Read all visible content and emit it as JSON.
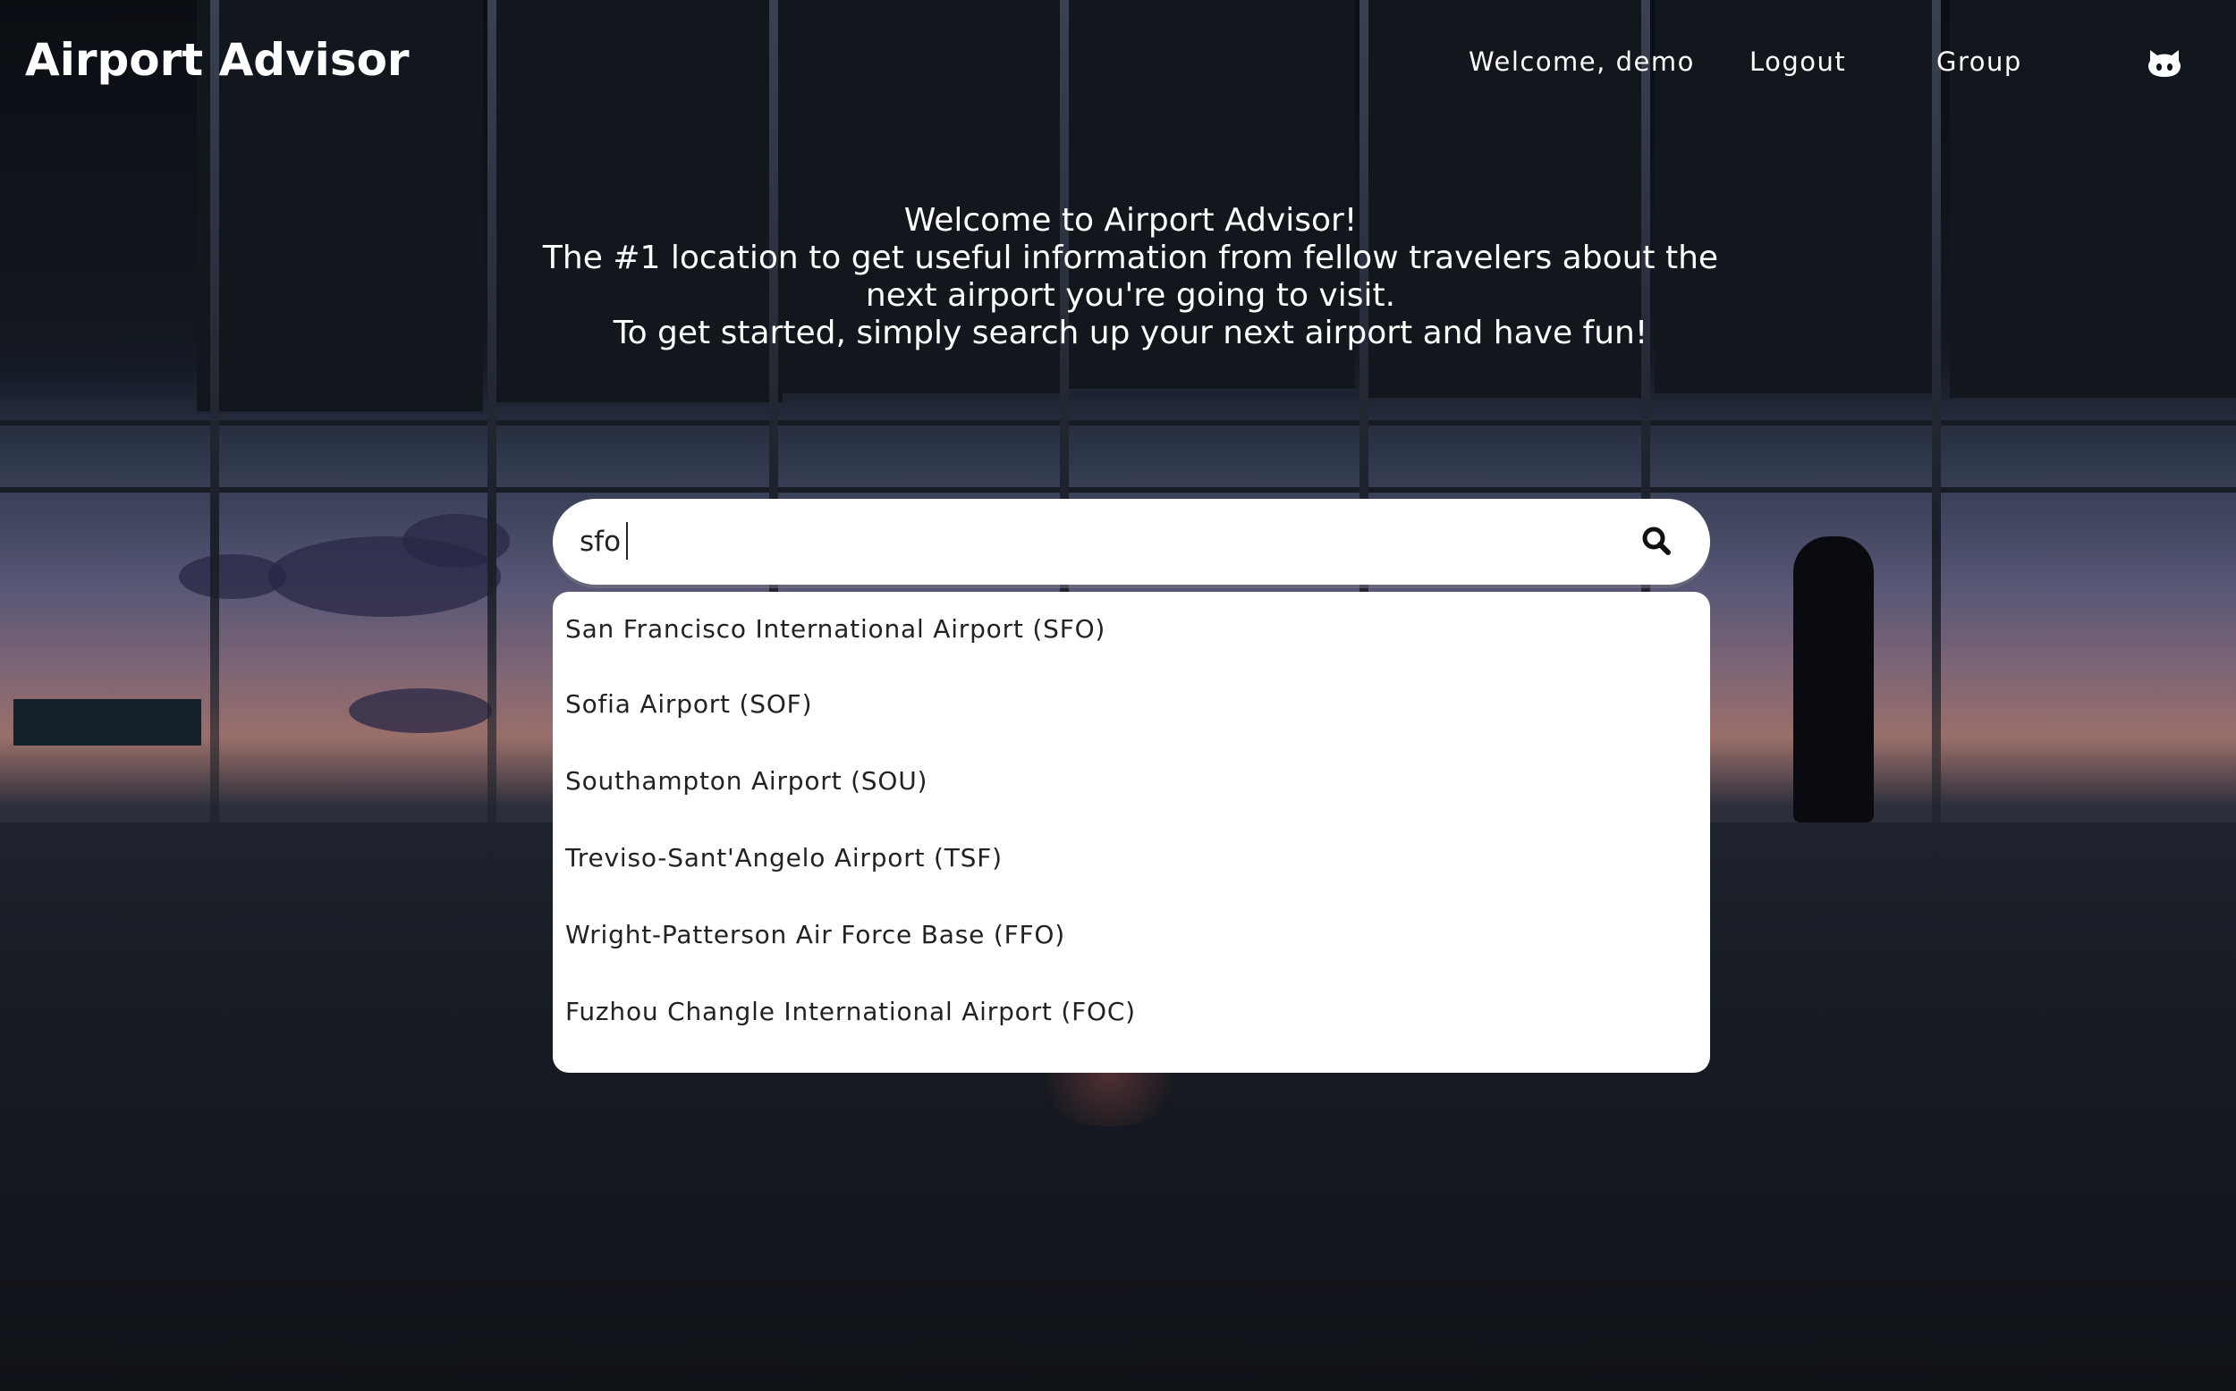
{
  "header": {
    "brand": "Airport Advisor",
    "nav": {
      "welcome": "Welcome, demo",
      "logout": "Logout",
      "group": "Group"
    },
    "github_icon": "github-icon"
  },
  "hero": {
    "lines": [
      "Welcome to Airport Advisor!",
      "The #1 location to get useful information from fellow travelers about the",
      "next airport you're going to visit.",
      "To get started, simply search up your next airport and have fun!"
    ]
  },
  "search": {
    "value": "sfo",
    "icon": "search-icon"
  },
  "suggestions": [
    "San Francisco International Airport (SFO)",
    "Sofia Airport (SOF)",
    "Southampton Airport (SOU)",
    "Treviso-Sant'Angelo Airport (TSF)",
    "Wright-Patterson Air Force Base (FFO)",
    "Fuzhou Changle International Airport (FOC)"
  ],
  "colors": {
    "text": "#ffffff",
    "dropdown_bg": "#ffffff",
    "dropdown_text": "#222222"
  }
}
